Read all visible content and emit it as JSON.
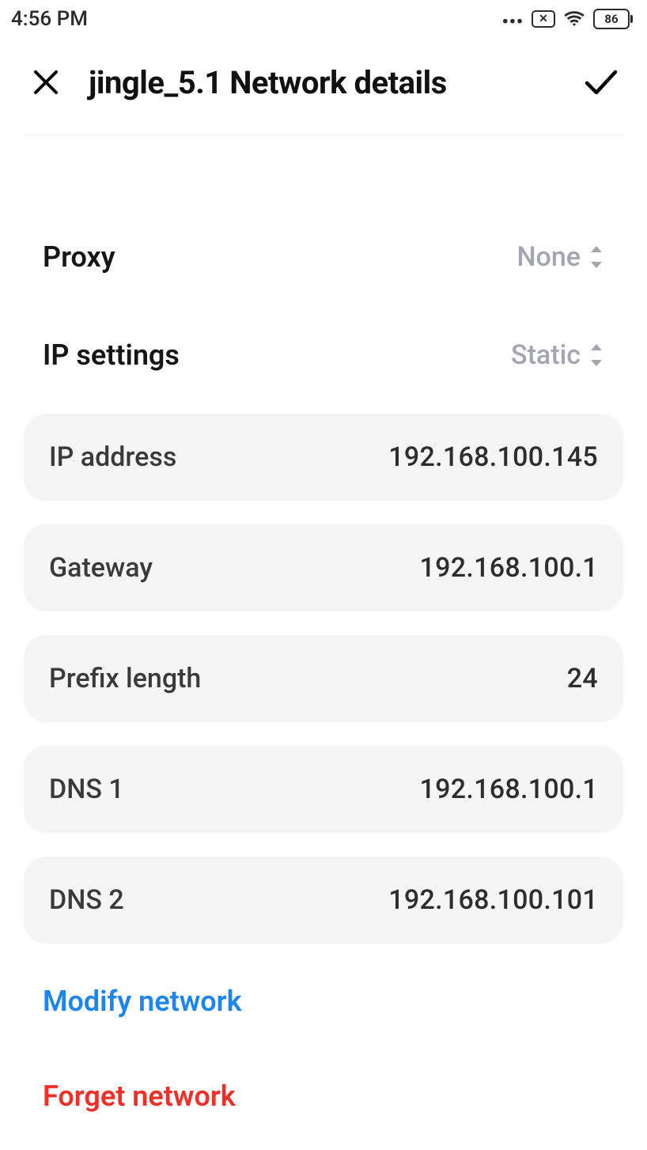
{
  "status": {
    "time": "4:56 PM",
    "battery": "86"
  },
  "header": {
    "title": "jingle_5.1 Network details"
  },
  "rows": {
    "proxy_label": "Proxy",
    "proxy_value": "None",
    "ip_settings_label": "IP settings",
    "ip_settings_value": "Static"
  },
  "fields": {
    "ip_address_label": "IP address",
    "ip_address_value": "192.168.100.145",
    "gateway_label": "Gateway",
    "gateway_value": "192.168.100.1",
    "prefix_label": "Prefix length",
    "prefix_value": "24",
    "dns1_label": "DNS 1",
    "dns1_value": "192.168.100.1",
    "dns2_label": "DNS 2",
    "dns2_value": "192.168.100.101"
  },
  "actions": {
    "modify": "Modify network",
    "forget": "Forget network"
  }
}
